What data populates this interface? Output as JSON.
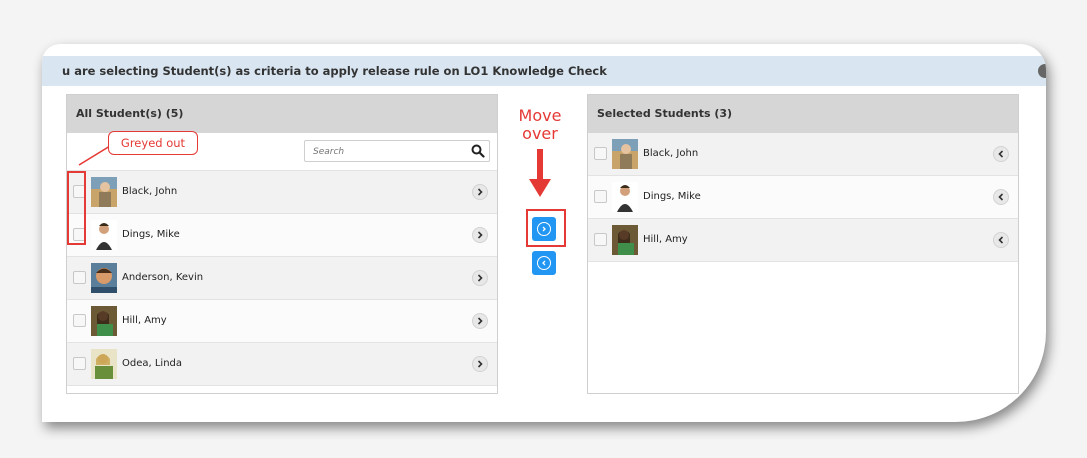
{
  "banner": {
    "text": "u are selecting Student(s) as criteria to apply release rule on LO1 Knowledge Check"
  },
  "left_panel": {
    "title": "All Student(s) (5)",
    "search_placeholder": "Search",
    "rows": [
      {
        "name": "Black, John",
        "avatar": "student-photo",
        "action_icon": "chevron-right-icon"
      },
      {
        "name": "Dings, Mike",
        "avatar": "student-photo",
        "action_icon": "chevron-right-icon"
      },
      {
        "name": "Anderson, Kevin",
        "avatar": "student-photo",
        "action_icon": "chevron-right-icon"
      },
      {
        "name": "Hill, Amy",
        "avatar": "student-photo",
        "action_icon": "chevron-right-icon"
      },
      {
        "name": "Odea, Linda",
        "avatar": "student-photo",
        "action_icon": "chevron-right-icon"
      }
    ]
  },
  "right_panel": {
    "title": "Selected Students (3)",
    "rows": [
      {
        "name": "Black, John",
        "avatar": "student-photo",
        "action_icon": "chevron-left-icon"
      },
      {
        "name": "Dings, Mike",
        "avatar": "student-photo",
        "action_icon": "chevron-left-icon"
      },
      {
        "name": "Hill, Amy",
        "avatar": "student-photo",
        "action_icon": "chevron-left-icon"
      }
    ]
  },
  "transfer_buttons": {
    "move_right_icon": "chevron-right-circle-icon",
    "move_left_icon": "chevron-left-circle-icon",
    "color": "#2196f3"
  },
  "annotations": {
    "callout": "Greyed out",
    "move_line1": "Move",
    "move_line2": "over",
    "color": "#e53935"
  }
}
